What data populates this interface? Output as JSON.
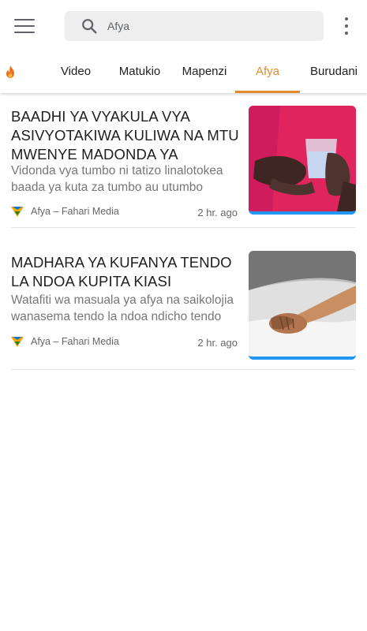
{
  "header": {
    "menu_icon": "hamburger-menu-icon",
    "search": {
      "value": "Afya",
      "icon": "search-icon"
    },
    "more_icon": "more-vertical-icon"
  },
  "tabs": {
    "items": [
      {
        "label": "",
        "icon": "flame-icon"
      },
      {
        "label": "Video"
      },
      {
        "label": "Matukio"
      },
      {
        "label": "Mapenzi"
      },
      {
        "label": "Afya"
      },
      {
        "label": "Burudani"
      }
    ],
    "active": "Afya",
    "accent_color": "#e08a2e"
  },
  "articles": [
    {
      "title": "BAADHI YA VYAKULA VYA ASIVYOTAKIWA KULIWA NA MTU MWENYE MADONDA YA",
      "excerpt": "Vidonda vya tumbo ni tatizo linalotokea baada ya kuta za tumbo au utumbo",
      "source": "Afya – Fahari Media",
      "time": "2 hr. ago"
    },
    {
      "title": "MADHARA YA KUFANYA TENDO LA NDOA KUPITA KIASI",
      "excerpt": "Watafiti wa masuala ya afya na saikolojia wanasema tendo la ndoa ndicho tendo",
      "source": "Afya – Fahari Media",
      "time": "2 hr. ago"
    }
  ],
  "colors": {
    "thumb_accent": "#2196f3",
    "search_bg": "#eeeeee"
  }
}
